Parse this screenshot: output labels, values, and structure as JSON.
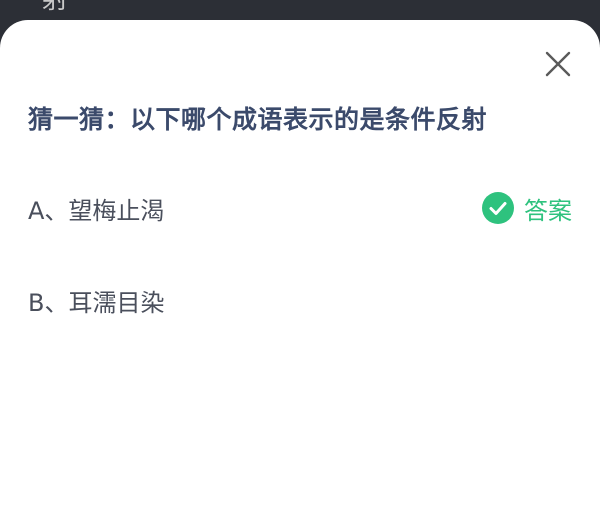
{
  "backdrop": {
    "partial_text": "射"
  },
  "dialog": {
    "close_icon": "close-icon",
    "question": "猜一猜：以下哪个成语表示的是条件反射",
    "options": [
      {
        "label": "A、望梅止渴",
        "is_answer": true,
        "answer_label": "答案",
        "answer_icon": "check-circle-icon"
      },
      {
        "label": "B、耳濡目染",
        "is_answer": false
      }
    ]
  },
  "colors": {
    "question_text": "#3b4a6b",
    "option_text": "#4a4f5c",
    "answer_accent": "#2ec27e",
    "backdrop": "#2c2f36",
    "sheet": "#ffffff"
  }
}
